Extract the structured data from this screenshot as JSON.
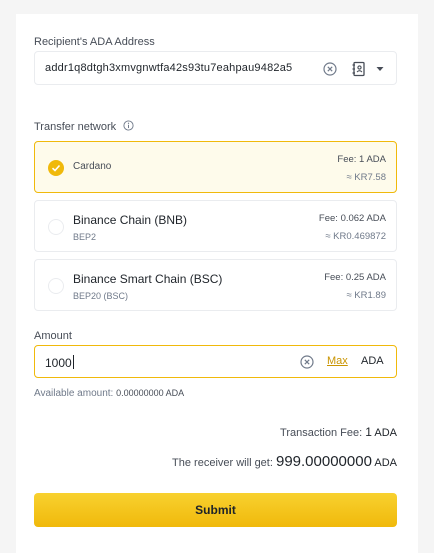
{
  "address": {
    "label": "Recipient's ADA Address",
    "value": "addr1q8dtgh3xmvgnwtfa42s93tu7eahpau9482a5"
  },
  "network": {
    "label": "Transfer network",
    "options": [
      {
        "name": "Cardano",
        "sub": "",
        "fee": "Fee: 1 ADA",
        "approx": "≈ KR7.58",
        "selected": true
      },
      {
        "name": "Binance Chain (BNB)",
        "sub": "BEP2",
        "fee": "Fee: 0.062 ADA",
        "approx": "≈ KR0.469872",
        "selected": false
      },
      {
        "name": "Binance Smart Chain (BSC)",
        "sub": "BEP20 (BSC)",
        "fee": "Fee: 0.25 ADA",
        "approx": "≈ KR1.89",
        "selected": false
      }
    ]
  },
  "amount": {
    "label": "Amount",
    "value": "1000",
    "max_label": "Max",
    "unit": "ADA"
  },
  "available": {
    "label": "Available amount:",
    "value": "0.00000000 ADA"
  },
  "summary": {
    "fee_label": "Transaction Fee:",
    "fee_value": "1",
    "fee_unit": "ADA",
    "receive_label": "The receiver will get:",
    "receive_value": "999.00000000",
    "receive_unit": "ADA"
  },
  "submit_label": "Submit",
  "colors": {
    "accent": "#f0b90b",
    "accent_link": "#c99400",
    "selected_bg": "#fefbeb"
  }
}
